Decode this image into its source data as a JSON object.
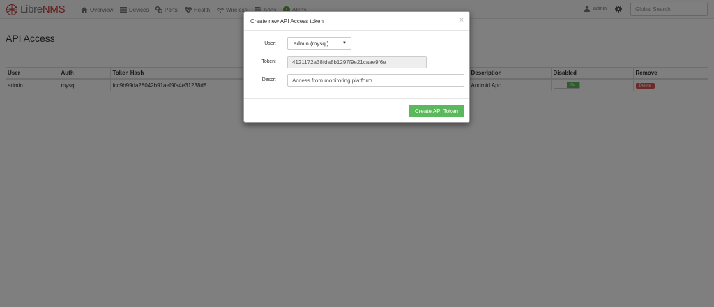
{
  "brand": {
    "name_part1": "Libre",
    "name_part2": "NMS"
  },
  "nav": {
    "items": [
      {
        "label": "Overview",
        "icon": "home-icon"
      },
      {
        "label": "Devices",
        "icon": "server-icon"
      },
      {
        "label": "Ports",
        "icon": "link-icon"
      },
      {
        "label": "Health",
        "icon": "heartbeat-icon"
      },
      {
        "label": "Wireless",
        "icon": "wifi-icon"
      },
      {
        "label": "Apps",
        "icon": "tasks-icon"
      },
      {
        "label": "Alerts",
        "icon": "exclamation-circle-icon"
      }
    ],
    "user_label": "admin",
    "search_placeholder": "Global Search"
  },
  "page": {
    "title": "API Access",
    "table": {
      "headers": [
        "User",
        "Auth",
        "Token Hash",
        "Description",
        "Disabled",
        "Remove"
      ],
      "rows": [
        {
          "user": "admin",
          "auth": "mysql",
          "token_hash": "fcc9b99da28042b91aef9fa4e31238d8",
          "description": "Android App",
          "disabled": "No",
          "remove": "Delete"
        }
      ]
    }
  },
  "modal": {
    "title": "Create new API Access token",
    "close_glyph": "×",
    "user_label": "User:",
    "user_value": "admin (mysql)",
    "token_label": "Token:",
    "token_value": "4121172a38fda8b1297f9e21caae9f6e",
    "descr_label": "Descr:",
    "descr_value": "Access from monitoring platform",
    "submit_label": "Create API Token"
  },
  "colors": {
    "brand_red": "#c53b39",
    "success": "#5cb85c",
    "danger": "#d9534f"
  }
}
